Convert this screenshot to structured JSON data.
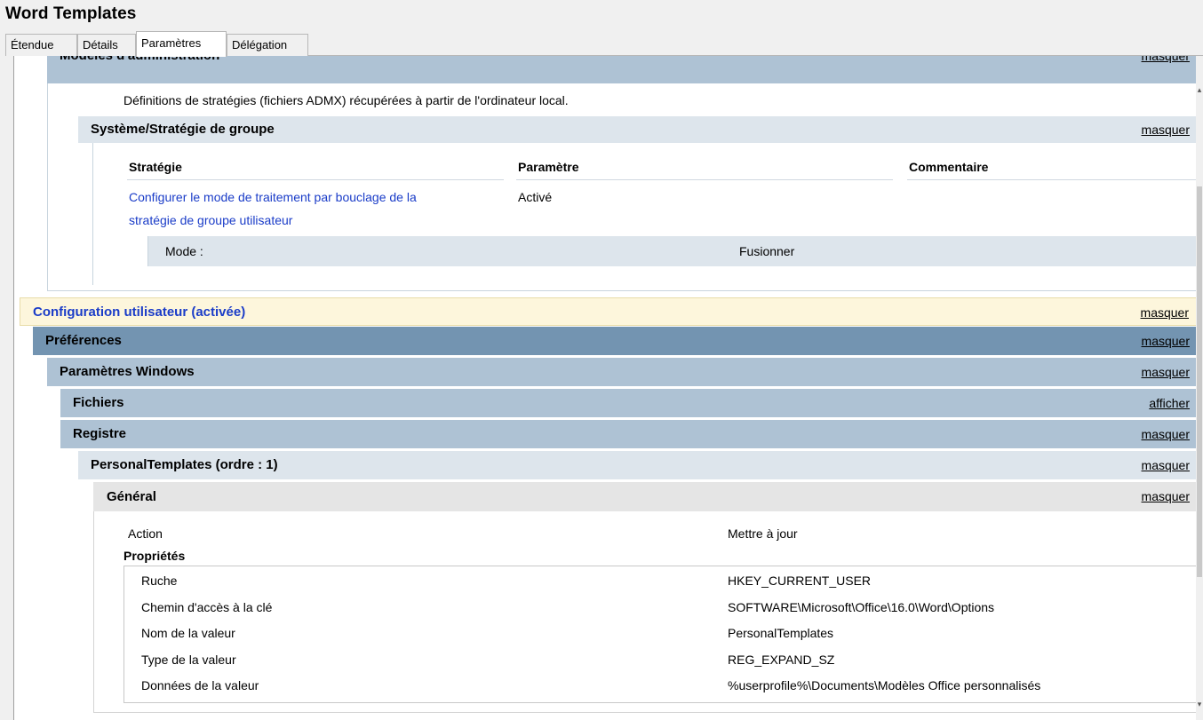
{
  "window": {
    "title": "Word Templates"
  },
  "tabs": [
    {
      "label": "Étendue"
    },
    {
      "label": "Détails"
    },
    {
      "label": "Paramètres"
    },
    {
      "label": "Délégation"
    }
  ],
  "active_tab": "Paramètres",
  "admin_templates": {
    "title": "Modèles d'administration",
    "action": "masquer",
    "description": "Définitions de stratégies (fichiers ADMX) récupérées à partir de l'ordinateur local."
  },
  "system_gp": {
    "title": "Système/Stratégie de groupe",
    "action": "masquer",
    "columns": {
      "policy": "Stratégie",
      "setting": "Paramètre",
      "comment": "Commentaire"
    },
    "policy": {
      "name_line1": "Configurer le mode de traitement par bouclage de la",
      "name_line2": "stratégie de groupe utilisateur",
      "value": "Activé"
    },
    "mode": {
      "label": "Mode :",
      "value": "Fusionner"
    }
  },
  "user_config": {
    "title": "Configuration utilisateur (activée)",
    "action": "masquer"
  },
  "preferences": {
    "title": "Préférences",
    "action": "masquer"
  },
  "windows_settings": {
    "title": "Paramètres Windows",
    "action": "masquer"
  },
  "files": {
    "title": "Fichiers",
    "action": "afficher"
  },
  "registry": {
    "title": "Registre",
    "action": "masquer"
  },
  "personal_templates": {
    "title": "PersonalTemplates (ordre : 1)",
    "action": "masquer"
  },
  "general": {
    "title": "Général",
    "action": "masquer",
    "action_label": "Action",
    "action_value": "Mettre à jour",
    "properties_label": "Propriétés",
    "properties": [
      {
        "label": "Ruche",
        "value": "HKEY_CURRENT_USER"
      },
      {
        "label": "Chemin d'accès à la clé",
        "value": "SOFTWARE\\Microsoft\\Office\\16.0\\Word\\Options"
      },
      {
        "label": "Nom de la valeur",
        "value": "PersonalTemplates"
      },
      {
        "label": "Type de la valeur",
        "value": "REG_EXPAND_SZ"
      },
      {
        "label": "Données de la valeur",
        "value": "%userprofile%\\Documents\\Modèles Office personnalisés"
      }
    ]
  },
  "colors": {
    "bar_light": "#dde5ec",
    "bar_mid": "#aec2d4",
    "bar_dark": "#7394b1",
    "user_config_bg": "#fdf6dc",
    "general_bg": "#e5e5e5",
    "link": "#1a3cc8"
  }
}
